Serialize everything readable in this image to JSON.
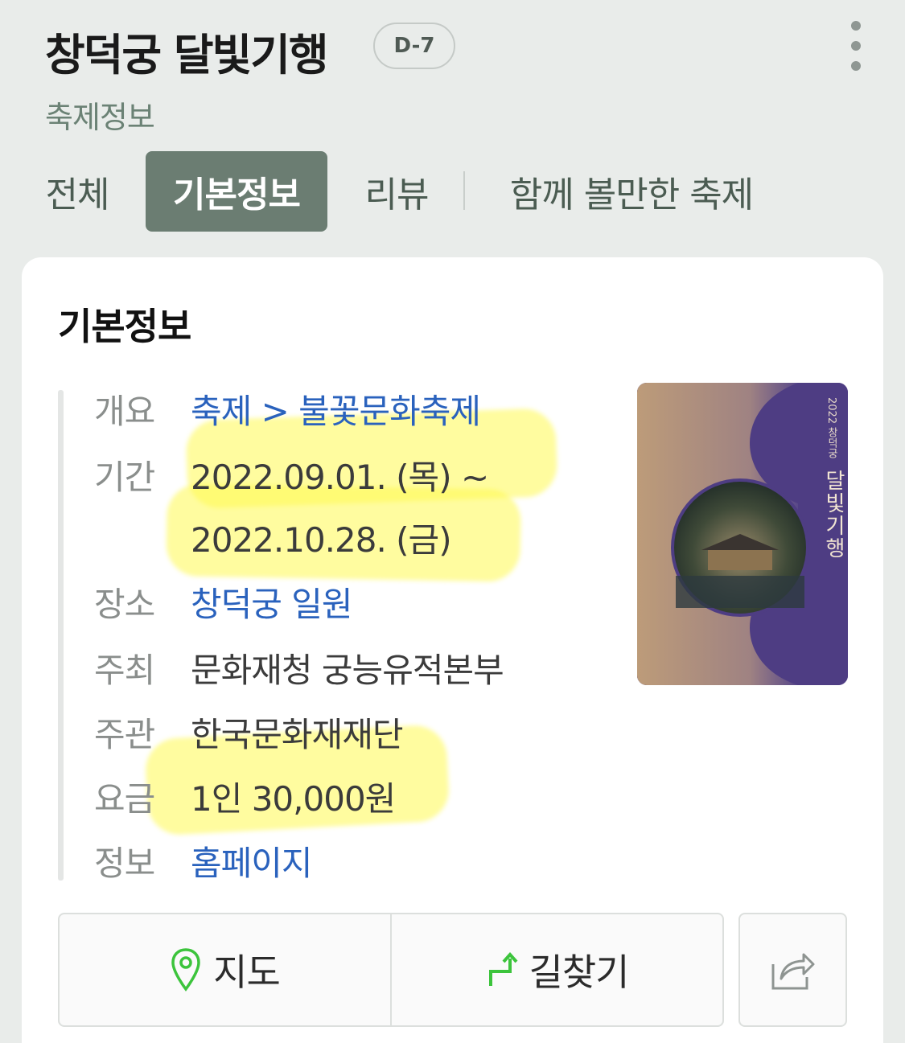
{
  "header": {
    "title": "창덕궁 달빛기행",
    "dday": "D-7",
    "more_icon": "more-vertical-icon",
    "subtitle": "축제정보"
  },
  "tabs": [
    {
      "label": "전체",
      "active": false
    },
    {
      "label": "기본정보",
      "active": true
    },
    {
      "label": "리뷰",
      "active": false
    },
    {
      "label": "함께 볼만한 축제",
      "active": false
    }
  ],
  "card": {
    "title": "기본정보",
    "rows": [
      {
        "label": "개요",
        "value": "축제 > 불꽃문화축제"
      },
      {
        "label": "기간",
        "value": "2022.09.01. (목) ~",
        "value2": "2022.10.28. (금)"
      },
      {
        "label": "장소",
        "value": "창덕궁 일원"
      },
      {
        "label": "주최",
        "value": "문화재청 궁능유적본부"
      },
      {
        "label": "주관",
        "value": "한국문화재재단"
      },
      {
        "label": "요금",
        "value": "1인 30,000원"
      },
      {
        "label": "정보",
        "value": "홈페이지"
      }
    ],
    "poster": {
      "small_text": "2022 창덕궁",
      "title": "달빛기행"
    }
  },
  "actions": {
    "map_label": "지도",
    "map_icon": "map-pin-icon",
    "directions_label": "길찾기",
    "directions_icon": "turn-arrow-icon",
    "share_icon": "share-icon"
  },
  "colors": {
    "background": "#e9ecea",
    "active_tab": "#6b7d72",
    "link": "#2a62bd",
    "highlight": "#fffa50",
    "map_icon": "#3cc43c"
  }
}
